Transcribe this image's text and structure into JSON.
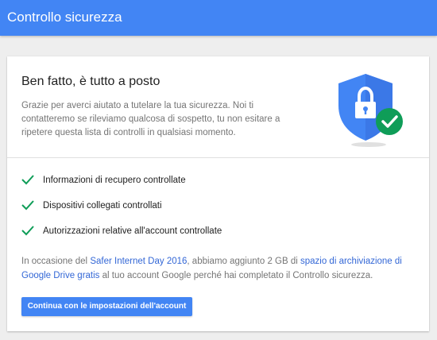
{
  "app": {
    "title": "Controllo sicurezza"
  },
  "summary": {
    "headline": "Ben fatto, è tutto a posto",
    "description": "Grazie per averci aiutato a tutelare la tua sicurezza. Noi ti contatteremo se rileviamo qualcosa di sospetto, tu non esitare a ripetere questa lista di controlli in qualsiasi momento.",
    "illustration_icon": "security-shield-lock-check-icon"
  },
  "checklist": [
    {
      "label": "Informazioni di recupero controllate",
      "icon": "checkmark-icon"
    },
    {
      "label": "Dispositivi collegati controllati",
      "icon": "checkmark-icon"
    },
    {
      "label": "Autorizzazioni relative all'account controllate",
      "icon": "checkmark-icon"
    }
  ],
  "promo": {
    "text_1": "In occasione del ",
    "link_1": "Safer Internet Day 2016",
    "text_2": ", abbiamo aggiunto 2 GB di ",
    "link_2": "spazio di archiviazione di Google Drive gratis",
    "text_3": " al tuo account Google perché hai completato il Controllo sicurezza."
  },
  "actions": {
    "continue_label": "Continua con le impostazioni dell'account"
  },
  "colors": {
    "header": "#4285f4",
    "shield": "#4285f4",
    "check_green": "#0f9d58",
    "link": "#3367d6",
    "button": "#4285f4"
  }
}
